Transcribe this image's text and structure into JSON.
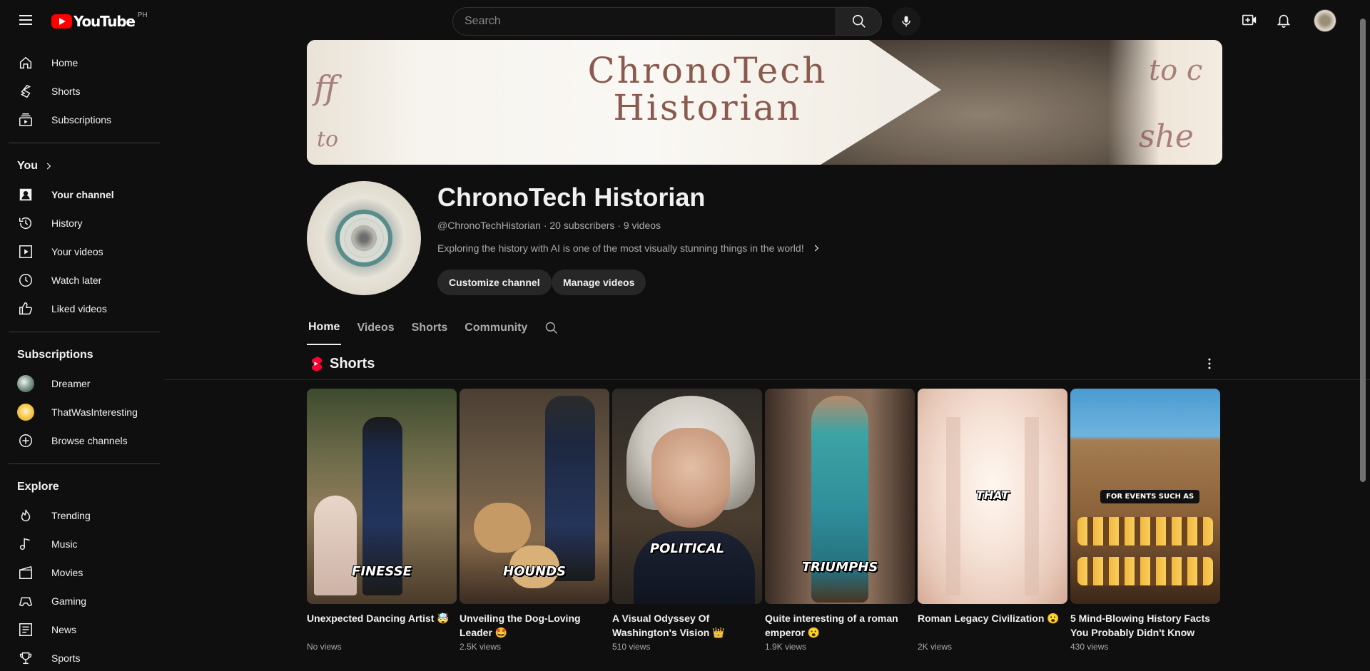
{
  "header": {
    "logo_text": "YouTube",
    "country_code": "PH",
    "search_placeholder": "Search"
  },
  "sidebar": {
    "main": [
      {
        "label": "Home",
        "icon": "home-icon"
      },
      {
        "label": "Shorts",
        "icon": "shorts-icon"
      },
      {
        "label": "Subscriptions",
        "icon": "subscriptions-icon"
      }
    ],
    "you_heading": "You",
    "you": [
      {
        "label": "Your channel",
        "icon": "your-channel-icon"
      },
      {
        "label": "History",
        "icon": "history-icon"
      },
      {
        "label": "Your videos",
        "icon": "your-videos-icon"
      },
      {
        "label": "Watch later",
        "icon": "watch-later-icon"
      },
      {
        "label": "Liked videos",
        "icon": "liked-videos-icon"
      }
    ],
    "subscriptions_heading": "Subscriptions",
    "subscriptions": [
      {
        "label": "Dreamer"
      },
      {
        "label": "ThatWasInteresting"
      },
      {
        "label": "Browse channels"
      }
    ],
    "explore_heading": "Explore",
    "explore": [
      {
        "label": "Trending",
        "icon": "trending-icon"
      },
      {
        "label": "Music",
        "icon": "music-icon"
      },
      {
        "label": "Movies",
        "icon": "movies-icon"
      },
      {
        "label": "Gaming",
        "icon": "gaming-icon"
      },
      {
        "label": "News",
        "icon": "news-icon"
      },
      {
        "label": "Sports",
        "icon": "sports-icon"
      }
    ]
  },
  "banner": {
    "line1": "ChronoTech",
    "line2": "Historian"
  },
  "channel": {
    "name": "ChronoTech Historian",
    "meta": "@ChronoTechHistorian · 20 subscribers · 9 videos",
    "description": "Exploring the history with AI is one of the most visually stunning things in the world!",
    "customize_label": "Customize channel",
    "manage_label": "Manage videos"
  },
  "tabs": [
    "Home",
    "Videos",
    "Shorts",
    "Community"
  ],
  "shelf": {
    "title": "Shorts"
  },
  "shorts": [
    {
      "title": "Unexpected Dancing Artist 🤯",
      "views": "No views",
      "overlay": "FINESSE"
    },
    {
      "title": "Unveiling the Dog-Loving Leader 🤩",
      "views": "2.5K views",
      "overlay": "HOUNDS"
    },
    {
      "title": "A Visual Odyssey Of Washington's Vision 👑",
      "views": "510 views",
      "overlay": "POLITICAL"
    },
    {
      "title": "Quite interesting of a roman emperor 😮",
      "views": "1.9K views",
      "overlay": "TRIUMPHS"
    },
    {
      "title": "Roman Legacy Civilization 😮",
      "views": "2K views",
      "overlay": "THAT"
    },
    {
      "title": "5 Mind-Blowing History Facts You Probably Didn't Know",
      "views": "430 views",
      "overlay": "FOR EVENTS SUCH AS"
    }
  ],
  "colors": {
    "background": "#0f0f0f",
    "accent": "#ff0000"
  }
}
